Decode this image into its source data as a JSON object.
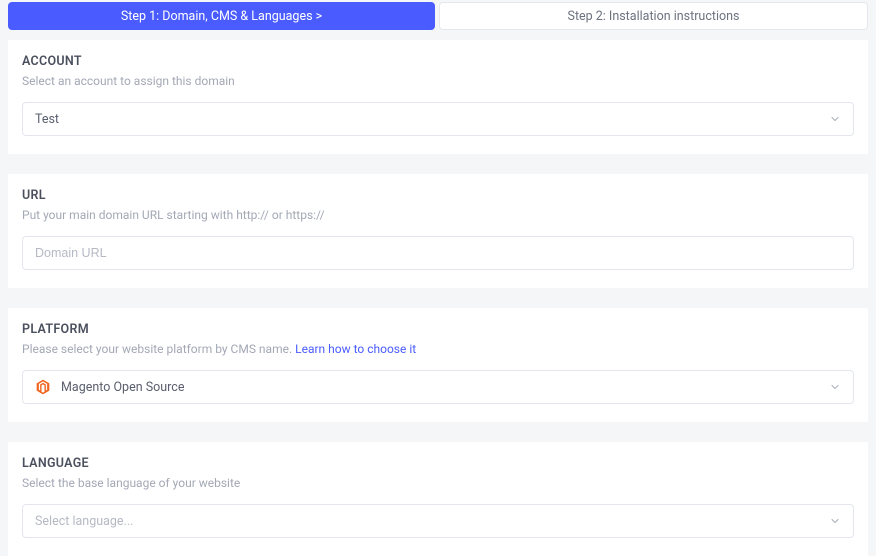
{
  "tabs": {
    "step1": "Step 1: Domain, CMS & Languages  >",
    "step2": "Step 2: Installation instructions"
  },
  "account": {
    "title": "ACCOUNT",
    "subtitle": "Select an account to assign this domain",
    "value": "Test"
  },
  "url": {
    "title": "URL",
    "subtitle": "Put your main domain URL starting with http:// or https://",
    "placeholder": "Domain URL",
    "value": ""
  },
  "platform": {
    "title": "PLATFORM",
    "subtitle_prefix": "Please select your website platform by CMS name.  ",
    "learn_link": "Learn how to choose it",
    "value": "Magento Open Source"
  },
  "language": {
    "title": "LANGUAGE",
    "subtitle": "Select the base language of your website",
    "placeholder": "Select language..."
  }
}
